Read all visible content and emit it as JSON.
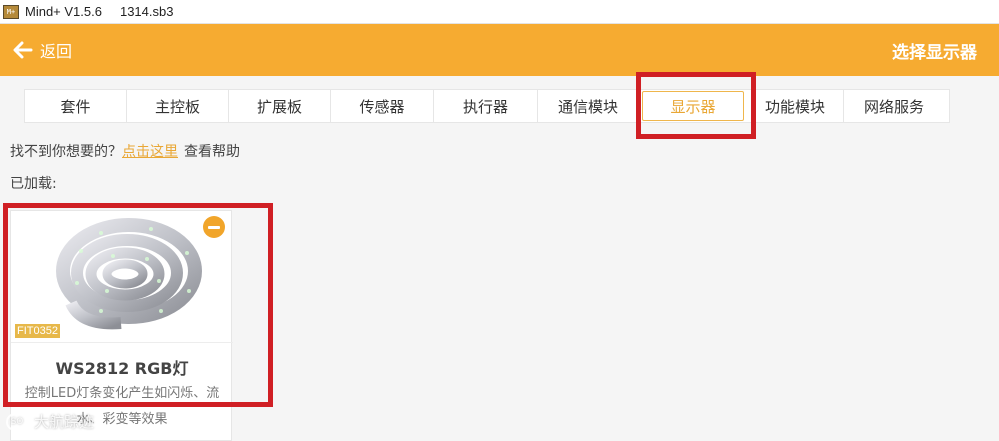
{
  "window": {
    "app_title": "Mind+ V1.5.6",
    "file_name": "1314.sb3",
    "app_icon": "mindplus-app-icon"
  },
  "header": {
    "back_label": "返回",
    "back_icon": "arrow-left-icon",
    "title": "选择显示器",
    "color": "#f6ab31"
  },
  "tabs": [
    {
      "label": "套件",
      "active": false
    },
    {
      "label": "主控板",
      "active": false
    },
    {
      "label": "扩展板",
      "active": false
    },
    {
      "label": "传感器",
      "active": false
    },
    {
      "label": "执行器",
      "active": false
    },
    {
      "label": "通信模块",
      "active": false
    },
    {
      "label": "显示器",
      "active": true
    },
    {
      "label": "功能模块",
      "active": false
    },
    {
      "label": "网络服务",
      "active": false
    }
  ],
  "help": {
    "prefix": "找不到你想要的？",
    "link": "点击这里",
    "suffix": "查看帮助"
  },
  "loaded_label": "已加载:",
  "card": {
    "code": "FIT0352",
    "name": "WS2812 RGB灯",
    "description": "控制LED灯条变化产生如闪烁、流水、彩变等效果",
    "remove_icon": "minus-circle-icon"
  },
  "watermark": "大航踪迹",
  "colors": {
    "accent": "#f6ab31",
    "link": "#e9a735",
    "highlight": "#d01f24"
  }
}
